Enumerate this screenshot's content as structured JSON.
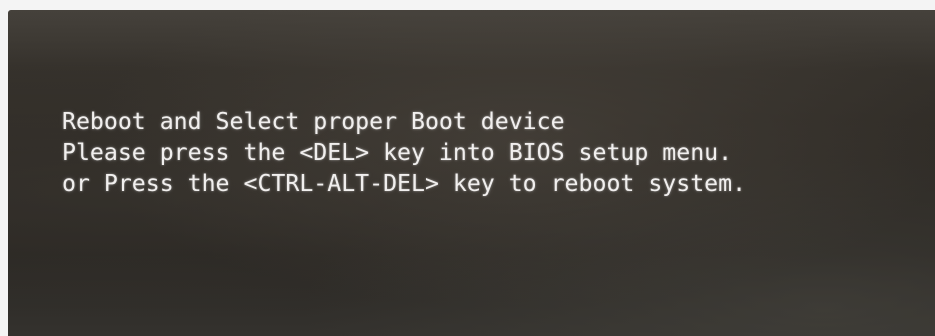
{
  "screen": {
    "lines": [
      "Reboot and Select proper Boot device",
      "Please press the <DEL> key into BIOS setup menu.",
      "or Press the <CTRL-ALT-DEL> key to reboot system."
    ]
  },
  "colors": {
    "text": "#f1efee",
    "background": "#2e2a25"
  }
}
